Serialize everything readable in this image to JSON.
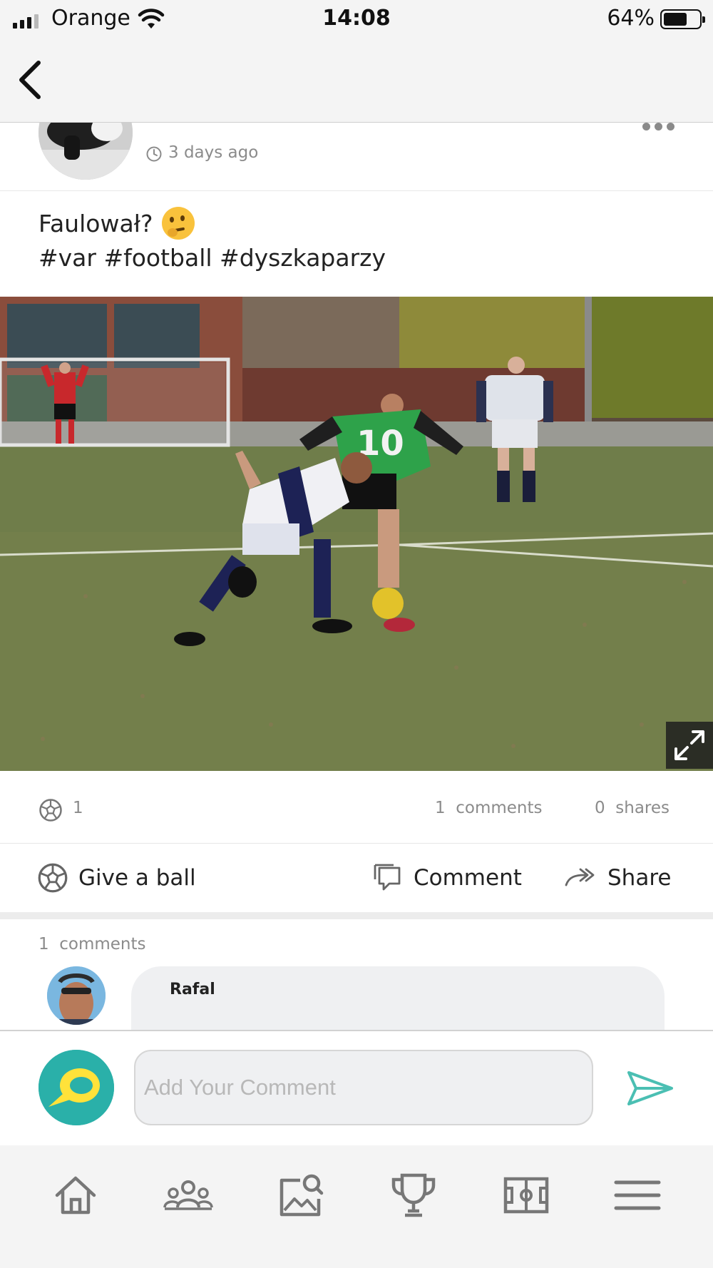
{
  "status_bar": {
    "carrier": "Orange",
    "time": "14:08",
    "battery": "64%",
    "battery_level": 0.64,
    "signal_bars": 3
  },
  "nav": {
    "back_icon": "chevron-left-icon"
  },
  "post": {
    "time_ago": "3 days ago",
    "caption": "Faulował?",
    "caption_emoji": "thinking-face-emoji",
    "hashtags": "#var #football #dyszkaparzy",
    "image_icon": "expand-icon"
  },
  "stats": {
    "balls": "1",
    "comments": "1  comments",
    "shares": "0  shares"
  },
  "actions": {
    "give_ball": "Give a ball",
    "comment": "Comment",
    "share": "Share"
  },
  "comments": {
    "count_label": "1  comments",
    "items": [
      {
        "author": "Rafal"
      }
    ]
  },
  "composer": {
    "placeholder": "Add Your Comment",
    "send_icon": "send-icon"
  },
  "tab_bar": {
    "tabs": [
      "home-icon",
      "people-icon",
      "gallery-search-icon",
      "trophy-icon",
      "pitch-icon",
      "menu-icon"
    ]
  },
  "colors": {
    "accent": "#4bbfb3",
    "muted_text": "#8b8b8b",
    "icon_gray": "#777777"
  }
}
